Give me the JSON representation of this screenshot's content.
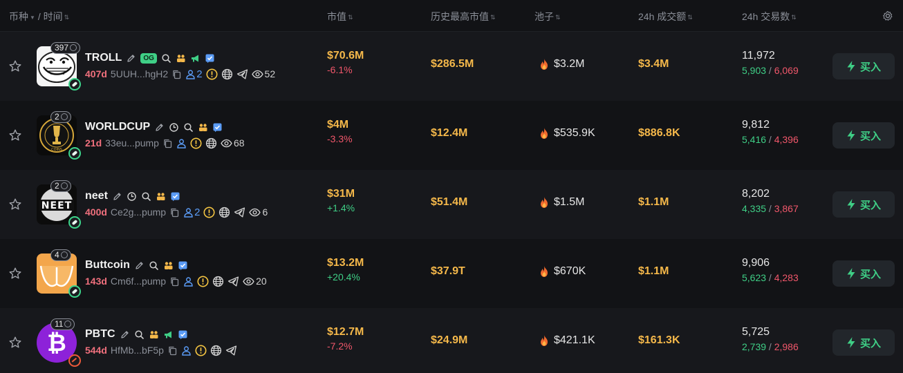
{
  "header": {
    "coin": "币种",
    "time": "/ 时间",
    "mcap": "市值",
    "ath": "历史最高市值",
    "pool": "池子",
    "vol": "24h 成交额",
    "txs": "24h 交易数"
  },
  "colors": {
    "accent": "#f5b84a",
    "positive": "#3fcf86",
    "negative": "#f2576b",
    "age": "#f0707d",
    "link": "#5b9cf6"
  },
  "buy_label": "买入",
  "og_label": "OG",
  "rows": [
    {
      "name": "TROLL",
      "holders": "397",
      "og": true,
      "age": "407d",
      "addr": "5UUH...hgH2",
      "holder_count": "2",
      "views": "52",
      "mcap": "$70.6M",
      "change": "-6.1%",
      "ath": "$286.5M",
      "pool": "$3.2M",
      "vol": "$3.4M",
      "txs": "11,972",
      "buys": "5,903",
      "sells": "6,069"
    },
    {
      "name": "WORLDCUP",
      "holders": "2",
      "og": false,
      "age": "21d",
      "addr": "33eu...pump",
      "holder_count": "",
      "views": "68",
      "mcap": "$4M",
      "change": "-3.3%",
      "ath": "$12.4M",
      "pool": "$535.9K",
      "vol": "$886.8K",
      "txs": "9,812",
      "buys": "5,416",
      "sells": "4,396"
    },
    {
      "name": "neet",
      "holders": "2",
      "og": false,
      "age": "400d",
      "addr": "Ce2g...pump",
      "holder_count": "2",
      "views": "6",
      "mcap": "$31M",
      "change": "+1.4%",
      "ath": "$51.4M",
      "pool": "$1.5M",
      "vol": "$1.1M",
      "txs": "8,202",
      "buys": "4,335",
      "sells": "3,867"
    },
    {
      "name": "Buttcoin",
      "holders": "4",
      "og": false,
      "age": "143d",
      "addr": "Cm6f...pump",
      "holder_count": "",
      "views": "20",
      "mcap": "$13.2M",
      "change": "+20.4%",
      "ath": "$37.9T",
      "pool": "$670K",
      "vol": "$1.1M",
      "txs": "9,906",
      "buys": "5,623",
      "sells": "4,283"
    },
    {
      "name": "PBTC",
      "holders": "11",
      "og": false,
      "age": "544d",
      "addr": "HfMb...bF5p",
      "holder_count": "",
      "views": "",
      "mcap": "$12.7M",
      "change": "-7.2%",
      "ath": "$24.9M",
      "pool": "$421.1K",
      "vol": "$161.3K",
      "txs": "5,725",
      "buys": "2,739",
      "sells": "2,986"
    }
  ]
}
